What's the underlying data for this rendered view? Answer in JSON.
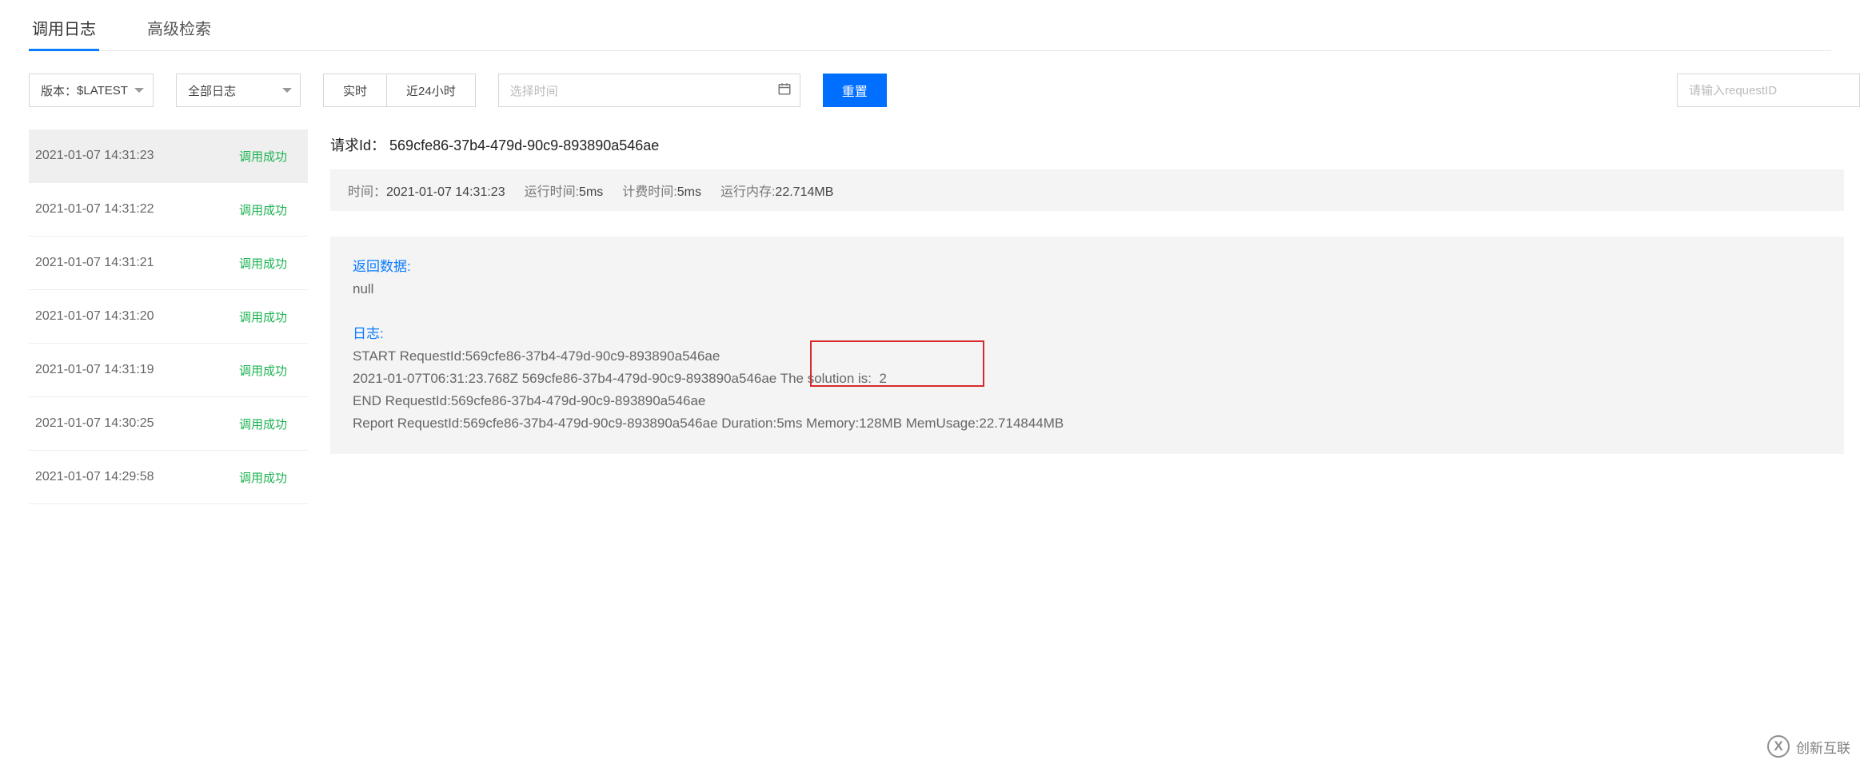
{
  "tabs": [
    {
      "label": "调用日志",
      "active": true
    },
    {
      "label": "高级检索",
      "active": false
    }
  ],
  "filters": {
    "version_label": "版本：",
    "version_value": "$LATEST",
    "logtype_value": "全部日志",
    "realtime_label": "实时",
    "last24_label": "近24小时",
    "time_placeholder": "选择时间",
    "reset_label": "重置",
    "search_placeholder": "请输入requestID"
  },
  "logs": [
    {
      "time": "2021-01-07 14:31:23",
      "status": "调用成功",
      "selected": true
    },
    {
      "time": "2021-01-07 14:31:22",
      "status": "调用成功",
      "selected": false
    },
    {
      "time": "2021-01-07 14:31:21",
      "status": "调用成功",
      "selected": false
    },
    {
      "time": "2021-01-07 14:31:20",
      "status": "调用成功",
      "selected": false
    },
    {
      "time": "2021-01-07 14:31:19",
      "status": "调用成功",
      "selected": false
    },
    {
      "time": "2021-01-07 14:30:25",
      "status": "调用成功",
      "selected": false
    },
    {
      "time": "2021-01-07 14:29:58",
      "status": "调用成功",
      "selected": false
    }
  ],
  "detail": {
    "request_id_label": "请求Id：",
    "request_id": "569cfe86-37b4-479d-90c9-893890a546ae",
    "meta": {
      "time_label": "时间：",
      "time_value": "2021-01-07 14:31:23",
      "runtime_label": "运行时间:",
      "runtime_value": "5ms",
      "billtime_label": "计费时间:",
      "billtime_value": "5ms",
      "mem_label": "运行内存:",
      "mem_value": "22.714MB"
    },
    "return_title": "返回数据:",
    "return_value": "null",
    "log_title": "日志:",
    "log_lines": [
      "START RequestId:569cfe86-37b4-479d-90c9-893890a546ae",
      "2021-01-07T06:31:23.768Z 569cfe86-37b4-479d-90c9-893890a546ae The solution is:  2",
      "END RequestId:569cfe86-37b4-479d-90c9-893890a546ae",
      "Report RequestId:569cfe86-37b4-479d-90c9-893890a546ae Duration:5ms Memory:128MB MemUsage:22.714844MB"
    ]
  },
  "watermark": "创新互联"
}
